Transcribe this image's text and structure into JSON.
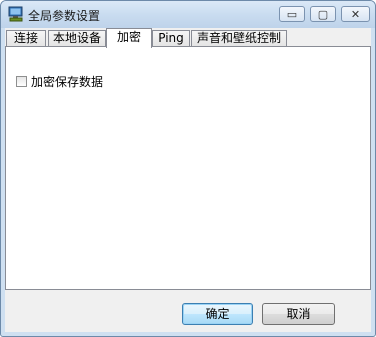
{
  "window": {
    "title": "全局参数设置",
    "icon": "monitor-app-icon"
  },
  "caption_buttons": {
    "minimize": "▭",
    "maximize": "▢",
    "close": "✕"
  },
  "tabs": [
    {
      "label": "连接",
      "active": false
    },
    {
      "label": "本地设备",
      "active": false
    },
    {
      "label": "加密",
      "active": true
    },
    {
      "label": "Ping",
      "active": false
    },
    {
      "label": "声音和壁纸控制",
      "active": false
    }
  ],
  "encryption": {
    "save_encrypted_label": "加密保存数据",
    "checked": false
  },
  "buttons": {
    "ok": "确定",
    "cancel": "取消"
  },
  "colors": {
    "title_bar": "#c9dcf0",
    "default_button_border": "#3c7fb1"
  }
}
